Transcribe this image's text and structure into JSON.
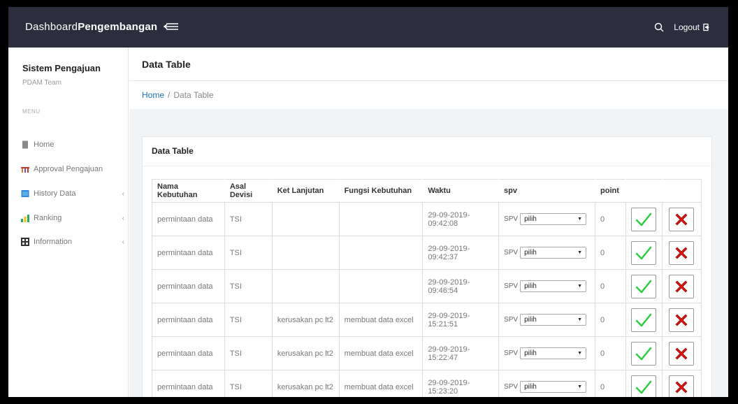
{
  "topbar": {
    "brand_light": "Dashboard",
    "brand_bold": "Pengembangan",
    "logout_label": "Logout"
  },
  "sidebar": {
    "title": "Sistem Pengajuan",
    "subtitle": "PDAM Team",
    "menu_label": "MENU",
    "items": [
      {
        "label": "Home",
        "icon": "page-icon",
        "color": "#8a8a8a"
      },
      {
        "label": "Approval Pengajuan",
        "icon": "rainbow-icon",
        "color": "#c0392b"
      },
      {
        "label": "History Data",
        "icon": "folder-icon",
        "color": "#2e86de",
        "chevron": "‹"
      },
      {
        "label": "Ranking",
        "icon": "bar-chart-icon",
        "color": "#27ae60",
        "chevron": "‹"
      },
      {
        "label": "Information",
        "icon": "grid-icon",
        "color": "#333333",
        "chevron": "‹"
      }
    ]
  },
  "page": {
    "title": "Data Table",
    "breadcrumb_home": "Home",
    "breadcrumb_sep": "/",
    "breadcrumb_current": "Data Table"
  },
  "card": {
    "title": "Data Table"
  },
  "table": {
    "headers": [
      "Nama Kebutuhan",
      "Asal Devisi",
      "Ket Lanjutan",
      "Fungsi Kebutuhan",
      "Waktu",
      "spv",
      "point"
    ],
    "spv_prefix": "SPV",
    "rows": [
      {
        "nama": "permintaan data",
        "asal": "TSI",
        "ket": "",
        "fungsi": "",
        "waktu": "29-09-2019-09:42:08",
        "spv": "pilih",
        "point": "0"
      },
      {
        "nama": "permintaan data",
        "asal": "TSI",
        "ket": "",
        "fungsi": "",
        "waktu": "29-09-2019-09:42:37",
        "spv": "pilih",
        "point": "0"
      },
      {
        "nama": "permintaan data",
        "asal": "TSI",
        "ket": "",
        "fungsi": "",
        "waktu": "29-09-2019-09:46:54",
        "spv": "pilih",
        "point": "0"
      },
      {
        "nama": "permintaan data",
        "asal": "TSI",
        "ket": "kerusakan pc lt2",
        "fungsi": "membuat data excel",
        "waktu": "29-09-2019-15:21:51",
        "spv": "pilih",
        "point": "0"
      },
      {
        "nama": "permintaan data",
        "asal": "TSI",
        "ket": "kerusakan pc lt2",
        "fungsi": "membuat data excel",
        "waktu": "29-09-2019-15:22:47",
        "spv": "pilih",
        "point": "0"
      },
      {
        "nama": "permintaan data",
        "asal": "TSI",
        "ket": "kerusakan pc lt2",
        "fungsi": "membuat data excel",
        "waktu": "29-09-2019-15:23:20",
        "spv": "pilih",
        "point": "0"
      }
    ]
  },
  "colors": {
    "topbar_bg": "#2c2e3e",
    "link": "#1e73be",
    "approve": "#2ecc40",
    "reject": "#e01010"
  }
}
